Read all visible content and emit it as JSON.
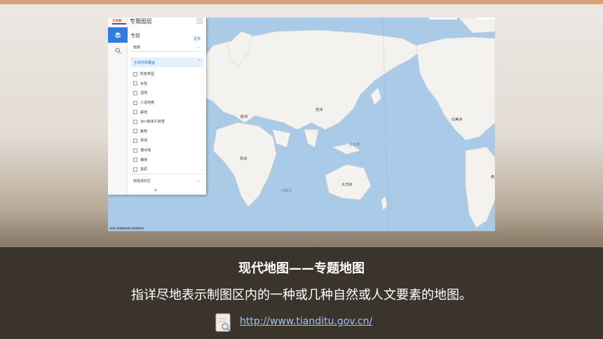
{
  "panel": {
    "title": "专题图层",
    "section_label": "专题",
    "section_link": "更多",
    "select_value": "植被",
    "group_label": "全球地表覆盖",
    "items": [
      "所有类型",
      "水体",
      "湿地",
      "人造地表",
      "耕地",
      "冰川和永久积雪",
      "森林",
      "草地",
      "灌木地",
      "裸地",
      "苔原"
    ],
    "footer_label": "特殊保护区"
  },
  "map": {
    "labels": {
      "europe": "欧洲",
      "asia": "亚洲",
      "africa": "非洲",
      "north_america": "北美洲",
      "oceania": "大洋洲",
      "pacific": "太平洋",
      "indian_ocean": "印度洋",
      "south_america_partial": "南"
    },
    "colors": {
      "ocean": "#a9cbe8",
      "land": "#f4f2ee",
      "accent": "#2f7de1"
    }
  },
  "caption": "图6　全球森林图层专题地图",
  "footer": {
    "heading": "现代地图——专题地图",
    "description": "指详尽地表示制图区内的一种或几种自然或人文要素的地图。",
    "url": "http://www.tianditu.gov.cn/"
  }
}
